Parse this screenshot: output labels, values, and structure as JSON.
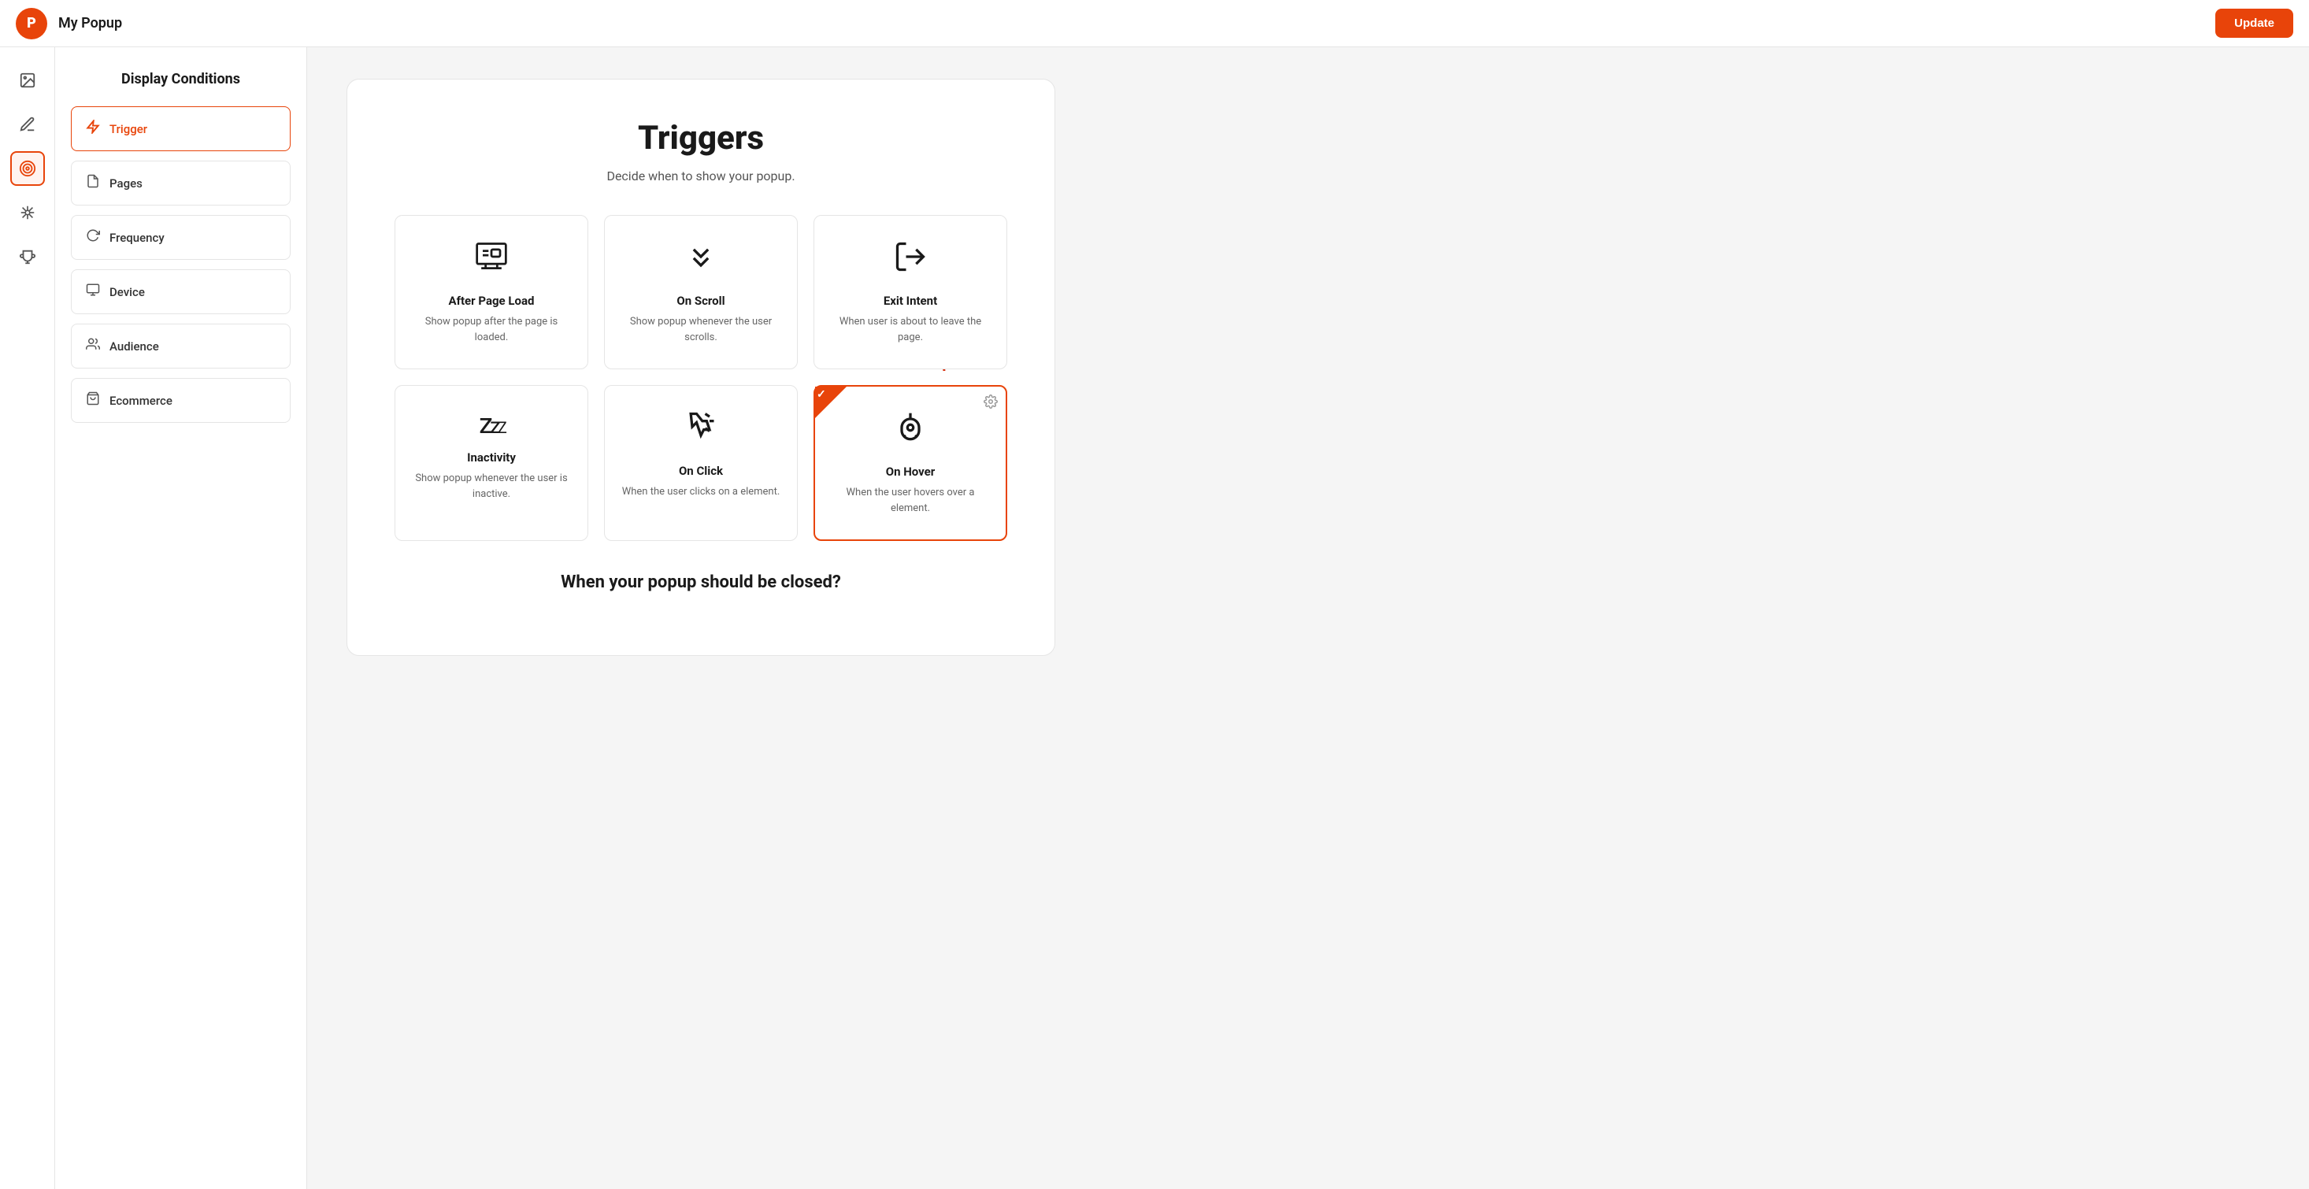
{
  "topbar": {
    "logo_text": "P",
    "title": "My Popup",
    "update_label": "Update"
  },
  "sidebar": {
    "icons": [
      {
        "name": "image-icon",
        "symbol": "🖼",
        "active": false
      },
      {
        "name": "pen-icon",
        "symbol": "✏️",
        "active": false
      },
      {
        "name": "target-icon",
        "symbol": "🎯",
        "active": true
      },
      {
        "name": "spider-icon",
        "symbol": "🕷",
        "active": false
      },
      {
        "name": "trophy-icon",
        "symbol": "🏆",
        "active": false
      }
    ]
  },
  "left_panel": {
    "title": "Display Conditions",
    "menu_items": [
      {
        "id": "trigger",
        "label": "Trigger",
        "icon": "⚡",
        "active": true
      },
      {
        "id": "pages",
        "label": "Pages",
        "icon": "📄",
        "active": false
      },
      {
        "id": "frequency",
        "label": "Frequency",
        "icon": "🔄",
        "active": false
      },
      {
        "id": "device",
        "label": "Device",
        "icon": "🖥",
        "active": false
      },
      {
        "id": "audience",
        "label": "Audience",
        "icon": "👥",
        "active": false
      },
      {
        "id": "ecommerce",
        "label": "Ecommerce",
        "icon": "🛍",
        "active": false
      }
    ]
  },
  "main": {
    "triggers_title": "Triggers",
    "triggers_subtitle": "Decide when to show your popup.",
    "trigger_cards": [
      {
        "id": "after-page-load",
        "icon_type": "page-load",
        "name": "After Page Load",
        "desc": "Show popup after the page is loaded.",
        "selected": false
      },
      {
        "id": "on-scroll",
        "icon_type": "scroll",
        "name": "On Scroll",
        "desc": "Show popup whenever the user scrolls.",
        "selected": false
      },
      {
        "id": "exit-intent",
        "icon_type": "exit",
        "name": "Exit Intent",
        "desc": "When user is about to leave the page.",
        "selected": false
      },
      {
        "id": "inactivity",
        "icon_type": "sleep",
        "name": "Inactivity",
        "desc": "Show popup whenever the user is inactive.",
        "selected": false
      },
      {
        "id": "on-click",
        "icon_type": "click",
        "name": "On Click",
        "desc": "When the user clicks on a element.",
        "selected": false
      },
      {
        "id": "on-hover",
        "icon_type": "hover",
        "name": "On Hover",
        "desc": "When the user hovers over a element.",
        "selected": true
      }
    ],
    "close_section_title": "When your popup should be closed?"
  },
  "colors": {
    "accent": "#e8440a",
    "border": "#e5e5e5",
    "text_dark": "#1a1a1a",
    "text_muted": "#666"
  }
}
